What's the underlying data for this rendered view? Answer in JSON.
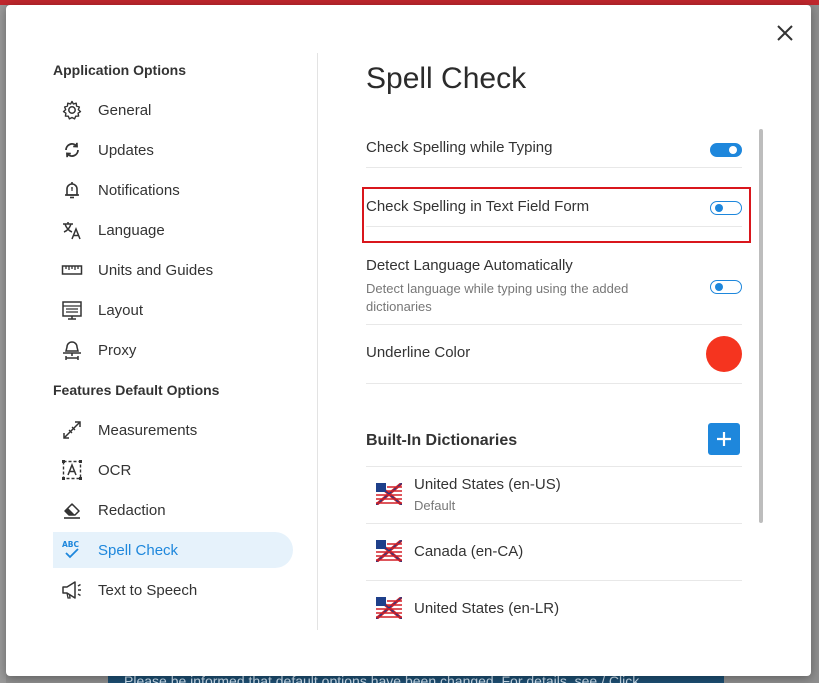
{
  "banner_text": "Please be informed that default options have been changed. For details, see / Click",
  "sidebar": {
    "section1_title": "Application Options",
    "section1_items": [
      {
        "label": "General",
        "icon": "gear-icon"
      },
      {
        "label": "Updates",
        "icon": "sync-icon"
      },
      {
        "label": "Notifications",
        "icon": "bell-icon"
      },
      {
        "label": "Language",
        "icon": "translate-icon"
      },
      {
        "label": "Units and Guides",
        "icon": "ruler-icon"
      },
      {
        "label": "Layout",
        "icon": "layout-icon"
      },
      {
        "label": "Proxy",
        "icon": "proxy-icon"
      }
    ],
    "section2_title": "Features Default Options",
    "section2_items": [
      {
        "label": "Measurements",
        "icon": "measure-icon"
      },
      {
        "label": "OCR",
        "icon": "ocr-icon"
      },
      {
        "label": "Redaction",
        "icon": "eraser-icon"
      },
      {
        "label": "Spell Check",
        "icon": "spellcheck-icon"
      },
      {
        "label": "Text to Speech",
        "icon": "megaphone-icon"
      }
    ]
  },
  "content": {
    "title": "Spell Check",
    "settings": [
      {
        "label": "Check Spelling while Typing",
        "enabled": true
      },
      {
        "label": "Check Spelling in Text Field Form",
        "enabled": false
      },
      {
        "label": "Detect Language Automatically",
        "sub": "Detect language while typing using the added dictionaries",
        "enabled": false
      }
    ],
    "underline_label": "Underline Color",
    "underline_color": "#f5341f",
    "dict_title": "Built-In Dictionaries",
    "dictionaries": [
      {
        "name": "United States (en-US)",
        "sub": "Default"
      },
      {
        "name": "Canada (en-CA)",
        "sub": ""
      },
      {
        "name": "United States (en-LR)",
        "sub": ""
      }
    ]
  },
  "colors": {
    "accent": "#1e87dc",
    "highlight": "#d9161c",
    "active_bg": "#e6f2fb"
  }
}
